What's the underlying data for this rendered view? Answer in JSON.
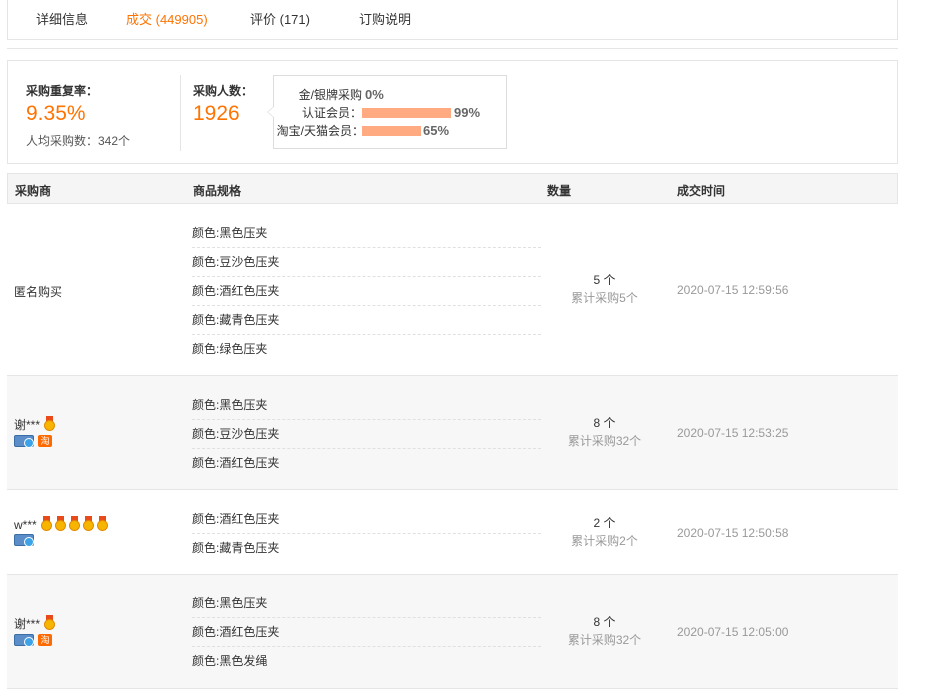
{
  "tabs": [
    {
      "label": "详细信息"
    },
    {
      "label": "成交 (449905)"
    },
    {
      "label": "评价 (171)"
    },
    {
      "label": "订购说明"
    }
  ],
  "stats": {
    "repeat_rate_label": "采购重复率：",
    "repeat_rate_value": "9.35%",
    "avg_label": "人均采购数：342个",
    "buyers_label": "采购人数：",
    "buyers_value": "1926",
    "bars": [
      {
        "label": "金/银牌采购",
        "pct": "0%",
        "value": 0
      },
      {
        "label": "认证会员：",
        "pct": "99%",
        "value": 99
      },
      {
        "label": "淘宝/天猫会员：",
        "pct": "65%",
        "value": 65
      }
    ]
  },
  "table": {
    "headers": [
      "采购商",
      "商品规格",
      "数量",
      "成交时间"
    ],
    "rows": [
      {
        "buyer": "匿名购买",
        "medals": 0,
        "specs": [
          "颜色:黑色压夹",
          "颜色:豆沙色压夹",
          "颜色:酒红色压夹",
          "颜色:藏青色压夹",
          "颜色:绿色压夹"
        ],
        "qty": "5 个",
        "qty_total": "累计采购5个",
        "time": "2020-07-15 12:59:56"
      },
      {
        "buyer": "谢***",
        "medals": 1,
        "specs": [
          "颜色:黑色压夹",
          "颜色:豆沙色压夹",
          "颜色:酒红色压夹"
        ],
        "qty": "8 个",
        "qty_total": "累计采购32个",
        "time": "2020-07-15 12:53:25",
        "tao_icon": "淘"
      },
      {
        "buyer": "w***",
        "medals": 5,
        "specs": [
          "颜色:酒红色压夹",
          "颜色:藏青色压夹"
        ],
        "qty": "2 个",
        "qty_total": "累计采购2个",
        "time": "2020-07-15 12:50:58"
      },
      {
        "buyer": "谢***",
        "medals": 1,
        "specs": [
          "颜色:黑色压夹",
          "颜色:酒红色压夹",
          "颜色:黑色发绳"
        ],
        "qty": "8 个",
        "qty_total": "累计采购32个",
        "time": "2020-07-15 12:05:00",
        "tao_icon": "淘"
      }
    ]
  }
}
